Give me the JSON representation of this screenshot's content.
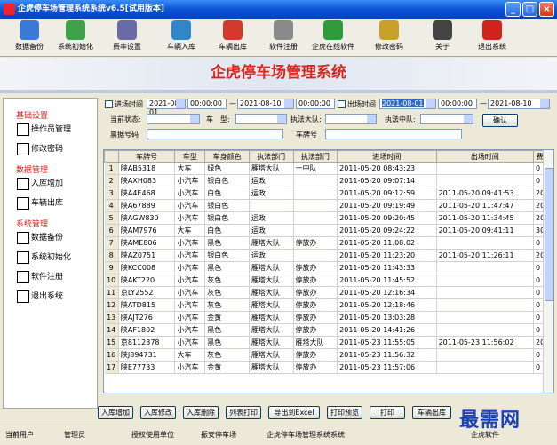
{
  "window": {
    "title": "企虎停车场管理系统系统v6.5[试用版本]"
  },
  "toolbar": [
    {
      "label": "数据备份",
      "icon": "backup-icon",
      "color": "#3a7bd5"
    },
    {
      "label": "系统初始化",
      "icon": "init-icon",
      "color": "#3fa24a"
    },
    {
      "label": "费率设置",
      "icon": "rate-icon",
      "color": "#6a6aa8"
    },
    {
      "label": "车辆入库",
      "icon": "car-in-icon",
      "color": "#2f86c9"
    },
    {
      "label": "车辆出库",
      "icon": "car-out-icon",
      "color": "#d33a2c"
    },
    {
      "label": "软件注册",
      "icon": "register-icon",
      "color": "#8a8a8a"
    },
    {
      "label": "企虎在线软件",
      "icon": "online-icon",
      "color": "#2e9a3a"
    },
    {
      "label": "修改密码",
      "icon": "password-icon",
      "color": "#c8a02a"
    },
    {
      "label": "关于",
      "icon": "about-icon",
      "color": "#444444"
    },
    {
      "label": "退出系统",
      "icon": "exit-icon",
      "color": "#d0231b"
    }
  ],
  "banner": {
    "title": "企虎停车场管理系统"
  },
  "sidebar": {
    "sections": [
      {
        "title": "基础设置",
        "items": [
          "操作员管理",
          "修改密码"
        ]
      },
      {
        "title": "数据管理",
        "items": [
          "入库增加",
          "车辆出库"
        ]
      },
      {
        "title": "系统管理",
        "items": [
          "数据备份",
          "系统初始化",
          "软件注册",
          "退出系统"
        ]
      }
    ]
  },
  "filters": {
    "in_time_label": "进场时间",
    "in_from": "2021-08-01",
    "in_from_time": "00:00:00",
    "in_to": "2021-08-10",
    "in_to_time": "00:00:00",
    "out_time_label": "出场时间",
    "out_from": "2021-08-01",
    "out_from_time": "00:00:00",
    "out_to": "2021-08-10",
    "status_label": "当前状态:",
    "car_type_label": "车　型:",
    "unit_label": "执法大队:",
    "dept_label": "执法中队:",
    "confirm_button": "确认",
    "ticket_label": "票据号码",
    "plate_label": "车牌号"
  },
  "table": {
    "columns": [
      "",
      "车牌号",
      "车型",
      "车身颜色",
      "执法部门",
      "执法部门",
      "进场时间",
      "出场时间",
      "费率"
    ],
    "rows": [
      [
        "1",
        "陕AB5318",
        "大车",
        "绿色",
        "雁塔大队",
        "一中队",
        "2011-05-20 08:43:23",
        "",
        "0"
      ],
      [
        "2",
        "陕AXH083",
        "小汽车",
        "银白色",
        "运政",
        "",
        "2011-05-20 09:07:14",
        "",
        "0"
      ],
      [
        "3",
        "陕A4E468",
        "小汽车",
        "白色",
        "运政",
        "",
        "2011-05-20 09:12:59",
        "2011-05-20 09:41:53",
        "20"
      ],
      [
        "4",
        "陕A67889",
        "小汽车",
        "银白色",
        "",
        "",
        "2011-05-20 09:19:49",
        "2011-05-20 11:47:47",
        "20"
      ],
      [
        "5",
        "陕AGW830",
        "小汽车",
        "银白色",
        "运政",
        "",
        "2011-05-20 09:20:45",
        "2011-05-20 11:34:45",
        "20"
      ],
      [
        "6",
        "陕AM7976",
        "大车",
        "白色",
        "运政",
        "",
        "2011-05-20 09:24:22",
        "2011-05-20 09:41:11",
        "30"
      ],
      [
        "7",
        "陕AME806",
        "小汽车",
        "黑色",
        "雁塔大队",
        "停放办",
        "2011-05-20 11:08:02",
        "",
        "0"
      ],
      [
        "8",
        "陕AZ0751",
        "小汽车",
        "银白色",
        "运政",
        "",
        "2011-05-20 11:23:20",
        "2011-05-20 11:26:11",
        "20"
      ],
      [
        "9",
        "陕KCC008",
        "小汽车",
        "黑色",
        "雁塔大队",
        "停放办",
        "2011-05-20 11:43:33",
        "",
        "0"
      ],
      [
        "10",
        "陕AKT220",
        "小汽车",
        "灰色",
        "雁塔大队",
        "停放办",
        "2011-05-20 11:45:52",
        "",
        "0"
      ],
      [
        "11",
        "京LY2552",
        "小汽车",
        "灰色",
        "雁塔大队",
        "停放办",
        "2011-05-20 12:16:34",
        "",
        "0"
      ],
      [
        "12",
        "陕ATD815",
        "小汽车",
        "灰色",
        "雁塔大队",
        "停放办",
        "2011-05-20 12:18:46",
        "",
        "0"
      ],
      [
        "13",
        "陕AJT276",
        "小汽车",
        "金黄",
        "雁塔大队",
        "停放办",
        "2011-05-20 13:03:28",
        "",
        "0"
      ],
      [
        "14",
        "陕AF1802",
        "小汽车",
        "黑色",
        "雁塔大队",
        "停放办",
        "2011-05-20 14:41:26",
        "",
        "0"
      ],
      [
        "15",
        "京8112378",
        "小汽车",
        "黑色",
        "雁塔大队",
        "雁塔大队",
        "2011-05-23 11:55:05",
        "2011-05-23 11:56:02",
        "20"
      ],
      [
        "16",
        "陕J894731",
        "大车",
        "灰色",
        "雁塔大队",
        "停放办",
        "2011-05-23 11:56:32",
        "",
        "0"
      ],
      [
        "17",
        "陕E77733",
        "小汽车",
        "金黄",
        "雁塔大队",
        "停放办",
        "2011-05-23 11:57:06",
        "",
        "0"
      ]
    ]
  },
  "actions": [
    "入库增加",
    "入库修改",
    "入库删除",
    "列表打印",
    "导出到Excel",
    "打印预览",
    "打印",
    "车辆出库"
  ],
  "status": {
    "current_user_label": "当前用户",
    "current_user": "管理员",
    "licensed_label": "授权使用单位",
    "licensed": "振安停车场",
    "system": "企虎停车场管理系统系统",
    "vendor": "企虎软件"
  },
  "watermark": "最需网"
}
